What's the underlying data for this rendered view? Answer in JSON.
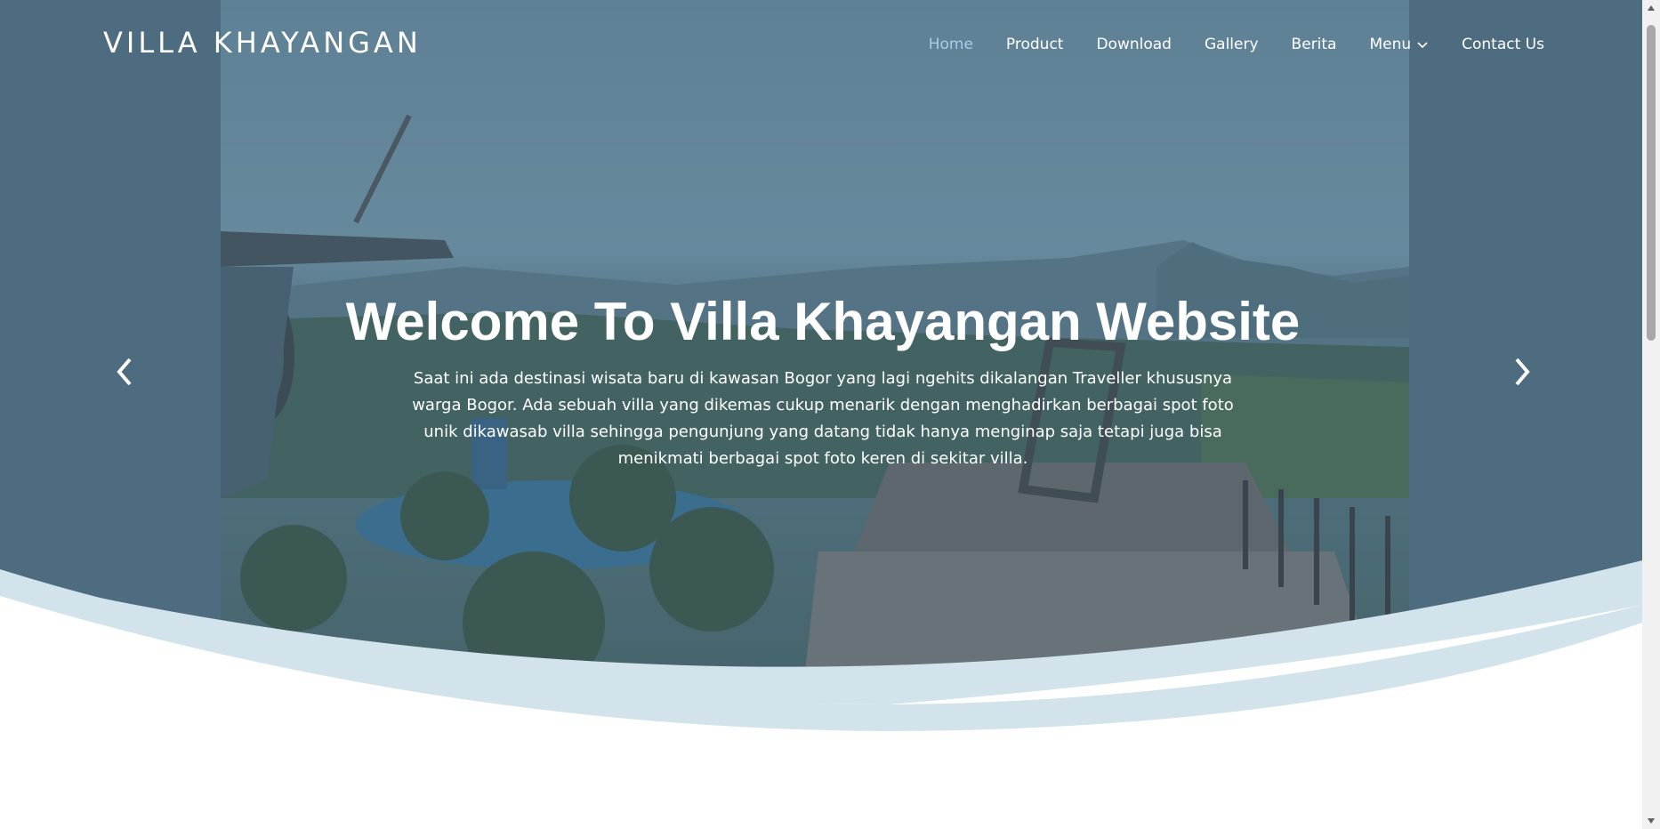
{
  "header": {
    "logo": "VILLA KHAYANGAN"
  },
  "nav": {
    "items": [
      {
        "label": "Home",
        "active": true
      },
      {
        "label": "Product"
      },
      {
        "label": "Download"
      },
      {
        "label": "Gallery"
      },
      {
        "label": "Berita"
      },
      {
        "label": "Menu",
        "has_dropdown": true
      },
      {
        "label": "Contact Us"
      }
    ]
  },
  "hero": {
    "title": "Welcome To Villa Khayangan Website",
    "text": "Saat ini ada destinasi wisata baru di kawasan Bogor yang lagi ngehits dikalangan Traveller khususnya warga Bogor. Ada sebuah villa yang dikemas cukup menarik dengan menghadirkan berbagai spot foto unik dikawasab villa sehingga pengunjung yang datang tidak hanya menginap saja tetapi juga bisa menikmati berbagai spot foto keren di sekitar villa.",
    "prev_icon": "chevron-left-icon",
    "next_icon": "chevron-right-icon",
    "image_description_icon": "hero-photo"
  },
  "colors": {
    "overlay": "#4f6f84",
    "wave_light": "#d2e3ec",
    "nav_active": "#a9cde6",
    "text": "#ffffff"
  }
}
